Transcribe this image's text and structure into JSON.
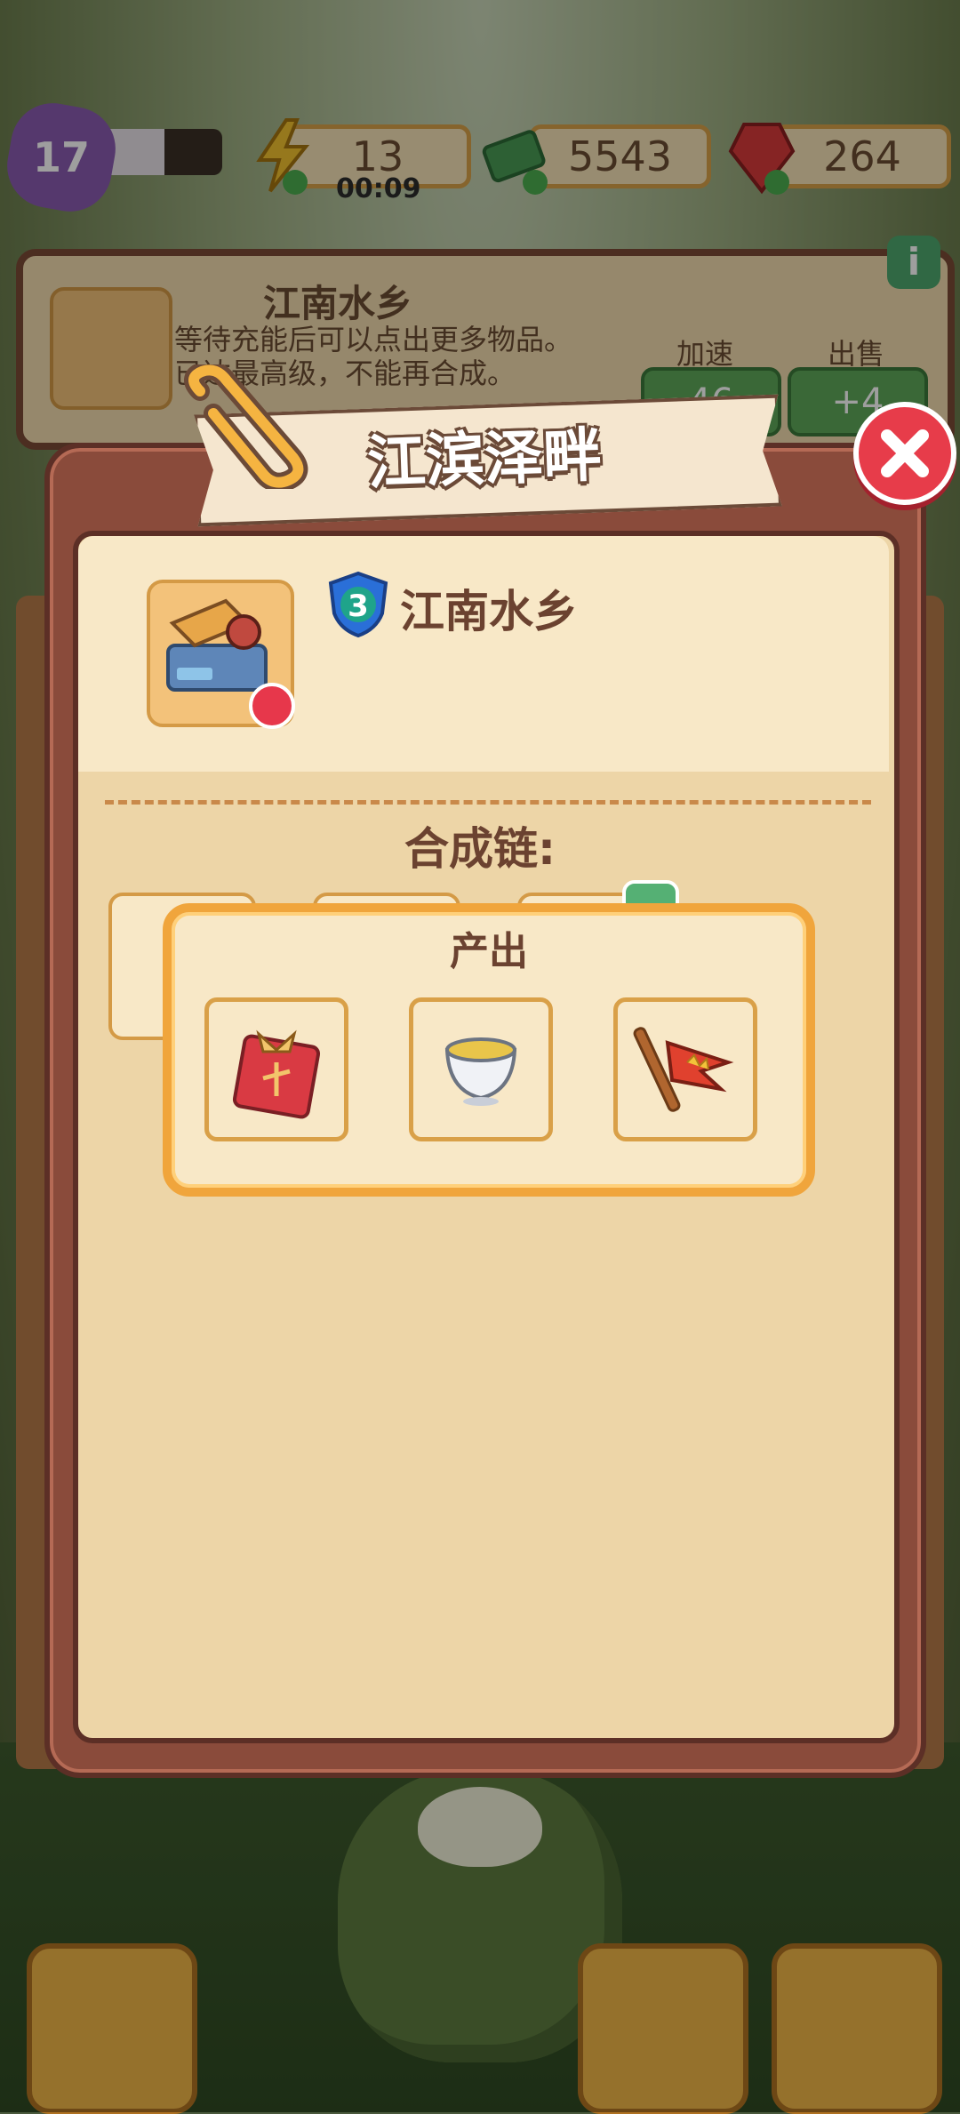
{
  "topbar": {
    "level": "17",
    "energy": "13",
    "energy_timer": "00:09",
    "cash": "5543",
    "gems": "264"
  },
  "info_panel": {
    "level": "3",
    "title": "江南水乡",
    "description_1": "等待充能后可以点出更多物品。",
    "description_2": "已达最高级，不能再合成。",
    "speed_label": "加速",
    "speed_cost": "46",
    "sell_label": "出售",
    "sell_value": "+4",
    "info_button": "i"
  },
  "modal": {
    "banner_title": "江滨泽畔",
    "item_level": "3",
    "item_name": "江南水乡",
    "chain_title": "合成链:",
    "popup_title": "产出",
    "outputs": [
      {
        "name": "red-envelope-icon"
      },
      {
        "name": "tea-cup-icon"
      },
      {
        "name": "flag-icon"
      }
    ]
  },
  "colors": {
    "accent_orange": "#f0a53c",
    "close_red": "#e73c4a",
    "frame_brown": "#8a4b3b",
    "panel_cream": "#edd5a7"
  }
}
